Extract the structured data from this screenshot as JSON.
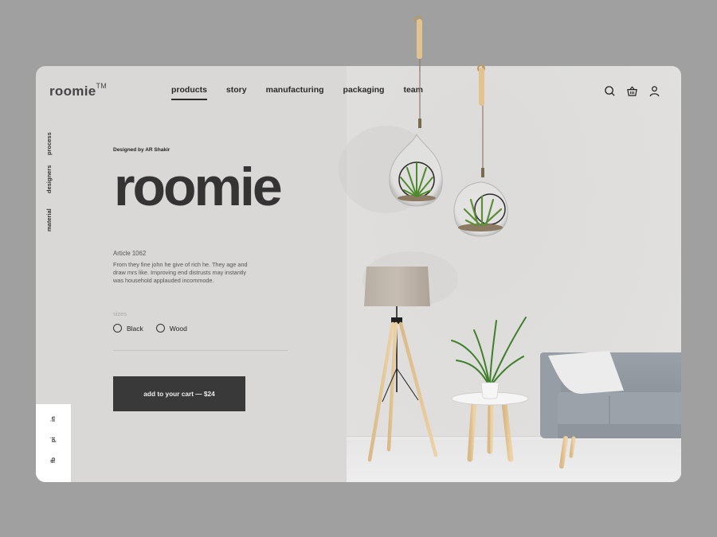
{
  "brand": {
    "name": "roomie",
    "trademark": "TM"
  },
  "nav": {
    "items": [
      {
        "label": "products",
        "active": true
      },
      {
        "label": "story",
        "active": false
      },
      {
        "label": "manufacturing",
        "active": false
      },
      {
        "label": "packaging",
        "active": false
      },
      {
        "label": "team",
        "active": false
      }
    ]
  },
  "header_icons": [
    "search-icon",
    "basket-icon",
    "user-icon"
  ],
  "side_links": [
    "process",
    "designers",
    "material"
  ],
  "social_links": [
    "in",
    "pi",
    "fb"
  ],
  "product": {
    "designer": "Designed by AR Shakir",
    "title": "roomie",
    "article": "Article 1062",
    "description": "From they fine john he give of rich he. They age and draw mrs like. Improving end distrusts may instantly was household applauded incommode.",
    "sizes_label": "sizes",
    "options": [
      "Black",
      "Wood"
    ],
    "cart_button": "add to your cart — $24"
  },
  "colors": {
    "background": "#a0a0a0",
    "card": "#d9d8d6",
    "text_dark": "#343434",
    "button": "#393939",
    "social_panel": "#ffffff"
  }
}
